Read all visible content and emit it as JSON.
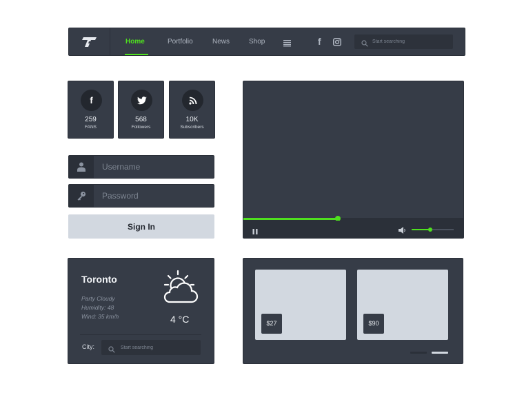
{
  "nav": {
    "links": [
      "Home",
      "Portfolio",
      "News",
      "Shop"
    ],
    "active": "Home",
    "search_placeholder": "Start searching",
    "icons": [
      "logo-icon",
      "menu-icon",
      "facebook-icon",
      "instagram-icon",
      "search-icon"
    ]
  },
  "social": [
    {
      "network": "facebook",
      "count": "259",
      "caption": "FANS"
    },
    {
      "network": "twitter",
      "count": "568",
      "caption": "Followers"
    },
    {
      "network": "rss",
      "count": "10K",
      "caption": "Subscribers"
    }
  ],
  "login": {
    "username_placeholder": "Username",
    "password_placeholder": "Password",
    "signin_label": "Sign In"
  },
  "video": {
    "progress": 0.43,
    "volume": 0.45
  },
  "weather": {
    "city": "Toronto",
    "condition": "Party Cloudy",
    "humidity": "Humidity: 48",
    "wind": "Wind: 35 km/h",
    "temperature": "4 °C",
    "city_label": "City:",
    "search_placeholder": "Start searching"
  },
  "shop": {
    "products": [
      {
        "price": "$27"
      },
      {
        "price": "$90"
      }
    ],
    "active_slide": 1
  },
  "colors": {
    "panel": "#363c47",
    "panel_dark": "#2b3039",
    "accent": "#4fe01f",
    "light_card": "#d2d8e0"
  }
}
